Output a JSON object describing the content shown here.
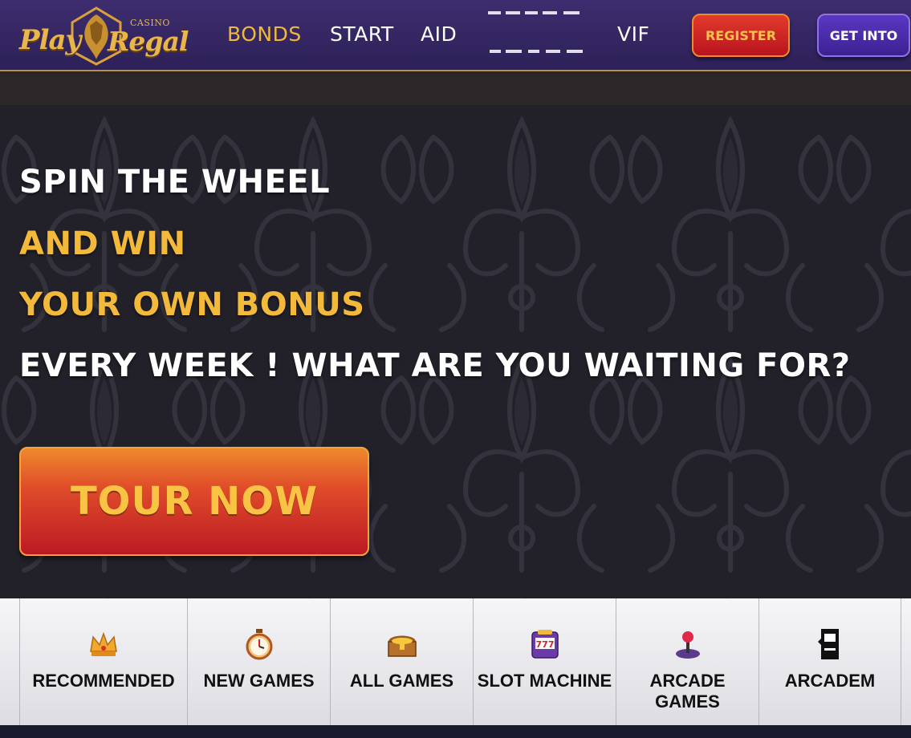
{
  "header": {
    "logo": {
      "word_play": "Play",
      "word_regal": "Regal",
      "word_casino": "CASINO"
    },
    "nav": [
      {
        "label": "BONDS",
        "active": true
      },
      {
        "label": "START",
        "active": false
      },
      {
        "label": "AID",
        "active": false
      },
      {
        "label": "VIF",
        "active": false
      }
    ],
    "register_label": "REGISTER",
    "login_label": "GET INTO"
  },
  "hero": {
    "line1": "SPIN THE WHEEL",
    "line2": "AND WIN",
    "line3": "YOUR OWN BONUS",
    "line4": "EVERY WEEK ! WHAT ARE YOU WAITING FOR?",
    "cta_label": "TOUR NOW"
  },
  "categories": [
    {
      "label": "RECOMMENDED",
      "icon": "crown-icon"
    },
    {
      "label": "NEW GAMES",
      "icon": "stopwatch-icon"
    },
    {
      "label": "ALL GAMES",
      "icon": "treasure-chest-icon"
    },
    {
      "label": "SLOT MACHINE",
      "icon": "slot-machine-icon"
    },
    {
      "label": "ARCADE GAMES",
      "icon": "joystick-icon"
    },
    {
      "label": "ARCADEM",
      "icon": "arcade-cabinet-icon"
    }
  ],
  "colors": {
    "header_bg": "#3e2d6f",
    "gold": "#f2b93b",
    "red_button": "#bc1a24",
    "purple_button": "#5b37c2"
  }
}
